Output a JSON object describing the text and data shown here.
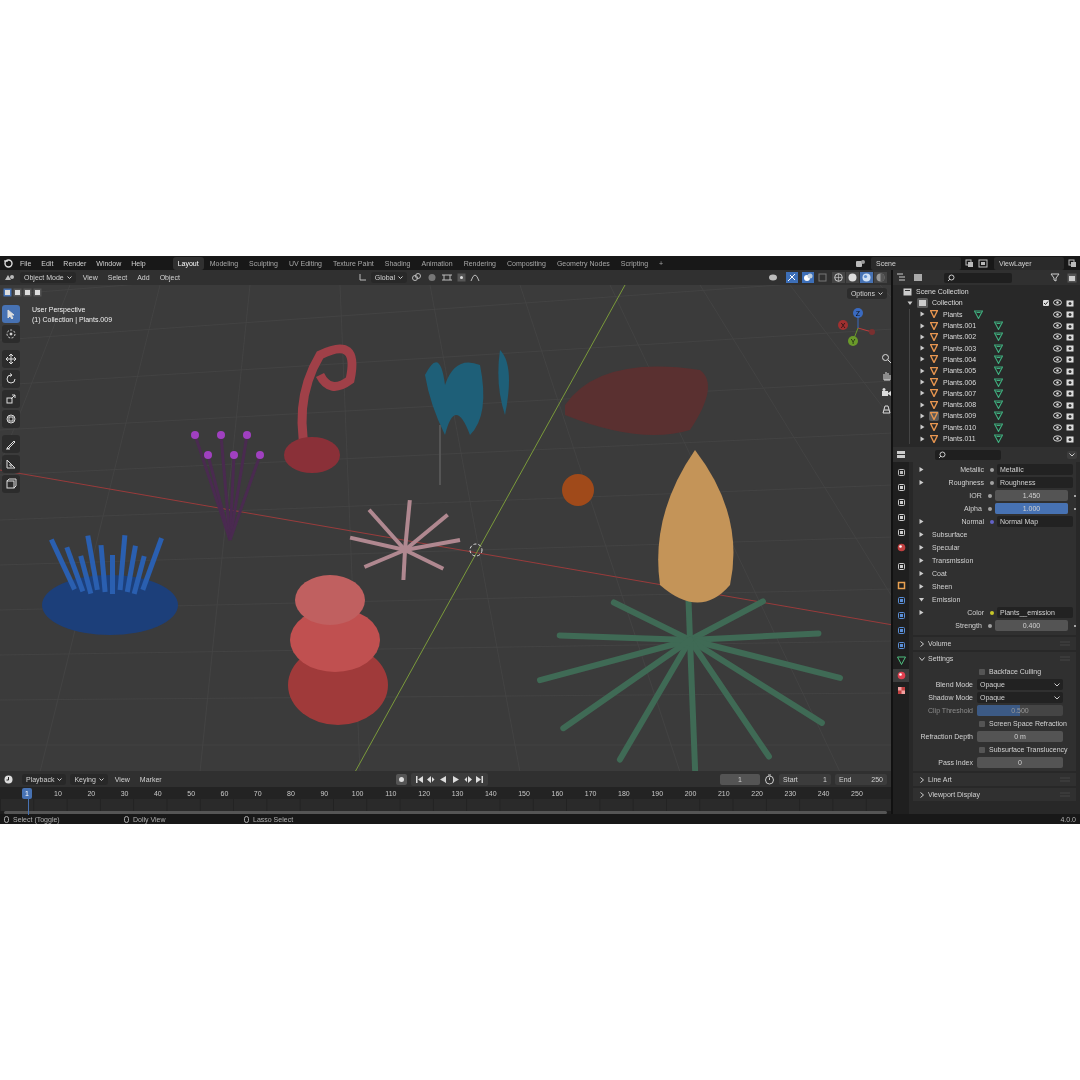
{
  "menu": [
    "File",
    "Edit",
    "Render",
    "Window",
    "Help"
  ],
  "workspaces": [
    {
      "label": "Layout",
      "selected": true
    },
    {
      "label": "Modeling",
      "selected": false
    },
    {
      "label": "Sculpting",
      "selected": false
    },
    {
      "label": "UV Editing",
      "selected": false
    },
    {
      "label": "Texture Paint",
      "selected": false
    },
    {
      "label": "Shading",
      "selected": false
    },
    {
      "label": "Animation",
      "selected": false
    },
    {
      "label": "Rendering",
      "selected": false
    },
    {
      "label": "Compositing",
      "selected": false
    },
    {
      "label": "Geometry Nodes",
      "selected": false
    },
    {
      "label": "Scripting",
      "selected": false
    }
  ],
  "add_workspace": "+",
  "scene": "Scene",
  "view_layer": "ViewLayer",
  "viewport_header": {
    "mode": "Object Mode",
    "menus": [
      "View",
      "Select",
      "Add",
      "Object"
    ],
    "orientation": "Global",
    "options": "Options"
  },
  "shading_modes": [
    {
      "kind": "wireframe",
      "selected": false
    },
    {
      "kind": "solid",
      "selected": false
    },
    {
      "kind": "material",
      "selected": true
    },
    {
      "kind": "rendered",
      "selected": false
    }
  ],
  "viewport": {
    "perspective": "User Perspective",
    "active_object": "(1) Collection | Plants.009",
    "gizmo_axes": [
      "X",
      "Y",
      "Z"
    ]
  },
  "toolbar": [
    {
      "kind": "select",
      "selected": true
    },
    {
      "kind": "cursor",
      "selected": false
    },
    {
      "kind": "move",
      "selected": false
    },
    {
      "kind": "rotate",
      "selected": false
    },
    {
      "kind": "scale",
      "selected": false
    },
    {
      "kind": "transform",
      "selected": false
    },
    {
      "kind": "annotate",
      "selected": false
    },
    {
      "kind": "measure",
      "selected": false
    },
    {
      "kind": "add-cube",
      "selected": false
    }
  ],
  "outliner": {
    "scene_collection": "Scene Collection",
    "collection": {
      "label": "Collection",
      "checked": true
    },
    "objects": [
      {
        "name": "Plants",
        "selected": false
      },
      {
        "name": "Plants.001",
        "selected": false
      },
      {
        "name": "Plants.002",
        "selected": false
      },
      {
        "name": "Plants.003",
        "selected": false
      },
      {
        "name": "Plants.004",
        "selected": false
      },
      {
        "name": "Plants.005",
        "selected": false
      },
      {
        "name": "Plants.006",
        "selected": false
      },
      {
        "name": "Plants.007",
        "selected": false
      },
      {
        "name": "Plants.008",
        "selected": false
      },
      {
        "name": "Plants.009",
        "selected": true
      },
      {
        "name": "Plants.010",
        "selected": false
      },
      {
        "name": "Plants.011",
        "selected": false
      }
    ]
  },
  "properties": {
    "tabs": [
      {
        "kind": "tool",
        "selected": false
      },
      {
        "kind": "render",
        "selected": false
      },
      {
        "kind": "output",
        "selected": false
      },
      {
        "kind": "view-layer",
        "selected": false
      },
      {
        "kind": "scene",
        "selected": false
      },
      {
        "kind": "world",
        "selected": false
      },
      {
        "kind": "collection",
        "selected": false
      },
      {
        "kind": "object",
        "selected": false
      },
      {
        "kind": "modifiers",
        "selected": false
      },
      {
        "kind": "particles",
        "selected": false
      },
      {
        "kind": "physics",
        "selected": false
      },
      {
        "kind": "constraints",
        "selected": false
      },
      {
        "kind": "data",
        "selected": false
      },
      {
        "kind": "material",
        "selected": true
      },
      {
        "kind": "texture",
        "selected": false
      }
    ],
    "rows": [
      {
        "kind": "link",
        "label": "Metallic",
        "value": "Metallic",
        "color": "#a1a1a1"
      },
      {
        "kind": "link",
        "label": "Roughness",
        "value": "Roughness",
        "color": "#a1a1a1"
      },
      {
        "kind": "number",
        "label": "IOR",
        "value": "1.450",
        "color": "#a1a1a1"
      },
      {
        "kind": "slider",
        "label": "Alpha",
        "value": "1.000",
        "level": 1,
        "color": "#a1a1a1"
      },
      {
        "kind": "link",
        "label": "Normal",
        "value": "Normal Map",
        "color": "#6363c7"
      },
      {
        "kind": "group",
        "label": "Subsurface",
        "expanded": false
      },
      {
        "kind": "group",
        "label": "Specular",
        "expanded": false
      },
      {
        "kind": "group",
        "label": "Transmission",
        "expanded": false
      },
      {
        "kind": "group",
        "label": "Coat",
        "expanded": false
      },
      {
        "kind": "group",
        "label": "Sheen",
        "expanded": false
      },
      {
        "kind": "group",
        "label": "Emission",
        "expanded": true
      },
      {
        "kind": "link",
        "label": "Color",
        "value": "Plants__emission",
        "color": "#c7c729"
      },
      {
        "kind": "number",
        "label": "Strength",
        "value": "0.400",
        "color": "#a1a1a1"
      }
    ],
    "panels": [
      {
        "title": "Volume",
        "expanded": false
      },
      {
        "title": "Settings",
        "expanded": true,
        "rows": [
          {
            "kind": "checkbox",
            "label": "Backface Culling",
            "checked": false
          },
          {
            "kind": "dropdown",
            "label": "Blend Mode",
            "value": "Opaque"
          },
          {
            "kind": "dropdown",
            "label": "Shadow Mode",
            "value": "Opaque"
          },
          {
            "kind": "slider",
            "label": "Clip Threshold",
            "value": "0.500",
            "level": 0.5,
            "disabled": true
          },
          {
            "kind": "checkbox",
            "label": "Screen Space Refraction",
            "checked": false
          },
          {
            "kind": "number",
            "label": "Refraction Depth",
            "value": "0 m"
          },
          {
            "kind": "checkbox",
            "label": "Subsurface Translucency",
            "checked": false
          },
          {
            "kind": "number",
            "label": "Pass Index",
            "value": "0"
          }
        ]
      },
      {
        "title": "Line Art",
        "expanded": false
      },
      {
        "title": "Viewport Display",
        "expanded": false
      }
    ]
  },
  "timeline": {
    "menus": [
      "Playback",
      "Keying",
      "View",
      "Marker"
    ],
    "current_frame": "1",
    "start_label": "Start",
    "start": "1",
    "end_label": "End",
    "end": "250",
    "playhead": "1",
    "ticks": [
      "10",
      "20",
      "30",
      "40",
      "50",
      "60",
      "70",
      "80",
      "90",
      "100",
      "110",
      "120",
      "130",
      "140",
      "150",
      "160",
      "170",
      "180",
      "190",
      "200",
      "210",
      "220",
      "230",
      "240",
      "250"
    ]
  },
  "status_bar": {
    "actions": [
      "Select (Toggle)",
      "Dolly View",
      "Lasso Select"
    ],
    "version": "4.0.0"
  }
}
